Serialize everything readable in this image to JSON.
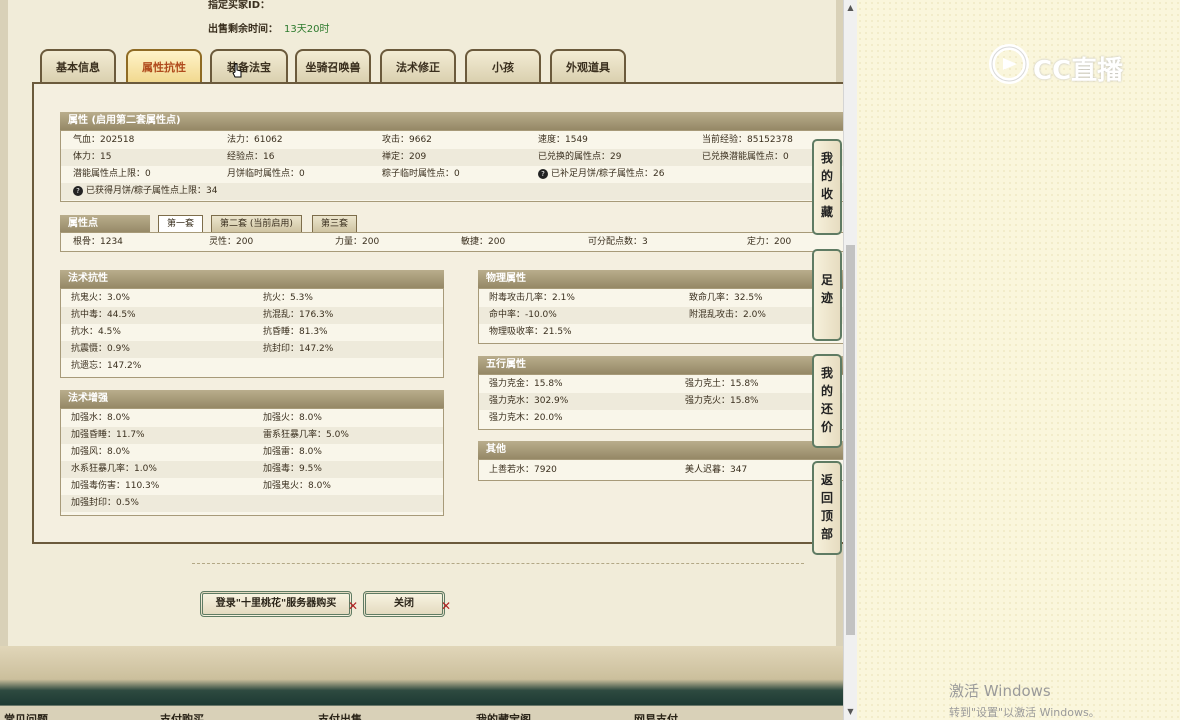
{
  "header": {
    "seller_label": "指定买家ID：",
    "sale_time_label": "出售剩余时间：",
    "sale_time_value": "13天20时"
  },
  "tabs": [
    "基本信息",
    "属性抗性",
    "装备法宝",
    "坐骑召唤兽",
    "法术修正",
    "小孩",
    "外观道具"
  ],
  "active_tab": "属性抗性",
  "attributes": {
    "title": "属性 (启用第二套属性点)",
    "rows": [
      [
        "气血：202518",
        "法力：61062",
        "攻击：9662",
        "速度：1549",
        "当前经验：85152378"
      ],
      [
        "体力：15",
        "经验点：16",
        "禅定：209",
        "已兑换的属性点：29",
        "已兑换潜能属性点：0"
      ],
      [
        "潜能属性点上限：0",
        "月饼临时属性点：0",
        "粽子临时属性点：0",
        "已补足月饼/粽子属性点：26",
        ""
      ],
      [
        "已获得月饼/粽子属性点上限：34",
        "",
        "",
        "",
        ""
      ]
    ]
  },
  "attr_points": {
    "title": "属性点",
    "subtabs": [
      "第一套",
      "第二套 (当前启用)",
      "第三套"
    ],
    "row": [
      "根骨：1234",
      "灵性：200",
      "力量：200",
      "敏捷：200",
      "可分配点数：3",
      "定力：200"
    ]
  },
  "magic_resist": {
    "title": "法术抗性",
    "rows": [
      [
        "抗鬼火：3.0%",
        "抗火：5.3%"
      ],
      [
        "抗中毒：44.5%",
        "抗混乱：176.3%"
      ],
      [
        "抗水：4.5%",
        "抗昏睡：81.3%"
      ],
      [
        "抗震慑：0.9%",
        "抗封印：147.2%"
      ],
      [
        "抗遗忘：147.2%",
        ""
      ]
    ]
  },
  "magic_boost": {
    "title": "法术增强",
    "rows": [
      [
        "加强水：8.0%",
        "加强火：8.0%"
      ],
      [
        "加强昏睡：11.7%",
        "雷系狂暴几率：5.0%"
      ],
      [
        "加强风：8.0%",
        "加强雷：8.0%"
      ],
      [
        "水系狂暴几率：1.0%",
        "加强毒：9.5%"
      ],
      [
        "加强毒伤害：110.3%",
        "加强鬼火：8.0%"
      ],
      [
        "加强封印：0.5%",
        ""
      ]
    ]
  },
  "physical": {
    "title": "物理属性",
    "rows": [
      [
        "附毒攻击几率：2.1%",
        "致命几率：32.5%"
      ],
      [
        "命中率：-10.0%",
        "附混乱攻击：2.0%"
      ],
      [
        "物理吸收率：21.5%",
        ""
      ]
    ]
  },
  "five_elements": {
    "title": "五行属性",
    "rows": [
      [
        "强力克金：15.8%",
        "强力克土：15.8%"
      ],
      [
        "强力克水：302.9%",
        "强力克火：15.8%"
      ],
      [
        "强力克木：20.0%",
        ""
      ]
    ]
  },
  "other": {
    "title": "其他",
    "rows": [
      [
        "上善若水：7920",
        "美人迟暮：347"
      ]
    ]
  },
  "buttons": {
    "login_buy": "登录\"十里桃花\"服务器购买",
    "close": "关闭"
  },
  "side_nav": [
    "我的收藏",
    "足迹",
    "我的还价",
    "返回顶部"
  ],
  "footer": [
    "常见问题",
    "支付购买",
    "支付出售",
    "我的藏宝阁",
    "网易支付"
  ],
  "logo_text": "CC直播",
  "watermark": {
    "title": "激活 Windows",
    "subtitle": "转到\"设置\"以激活 Windows。"
  }
}
